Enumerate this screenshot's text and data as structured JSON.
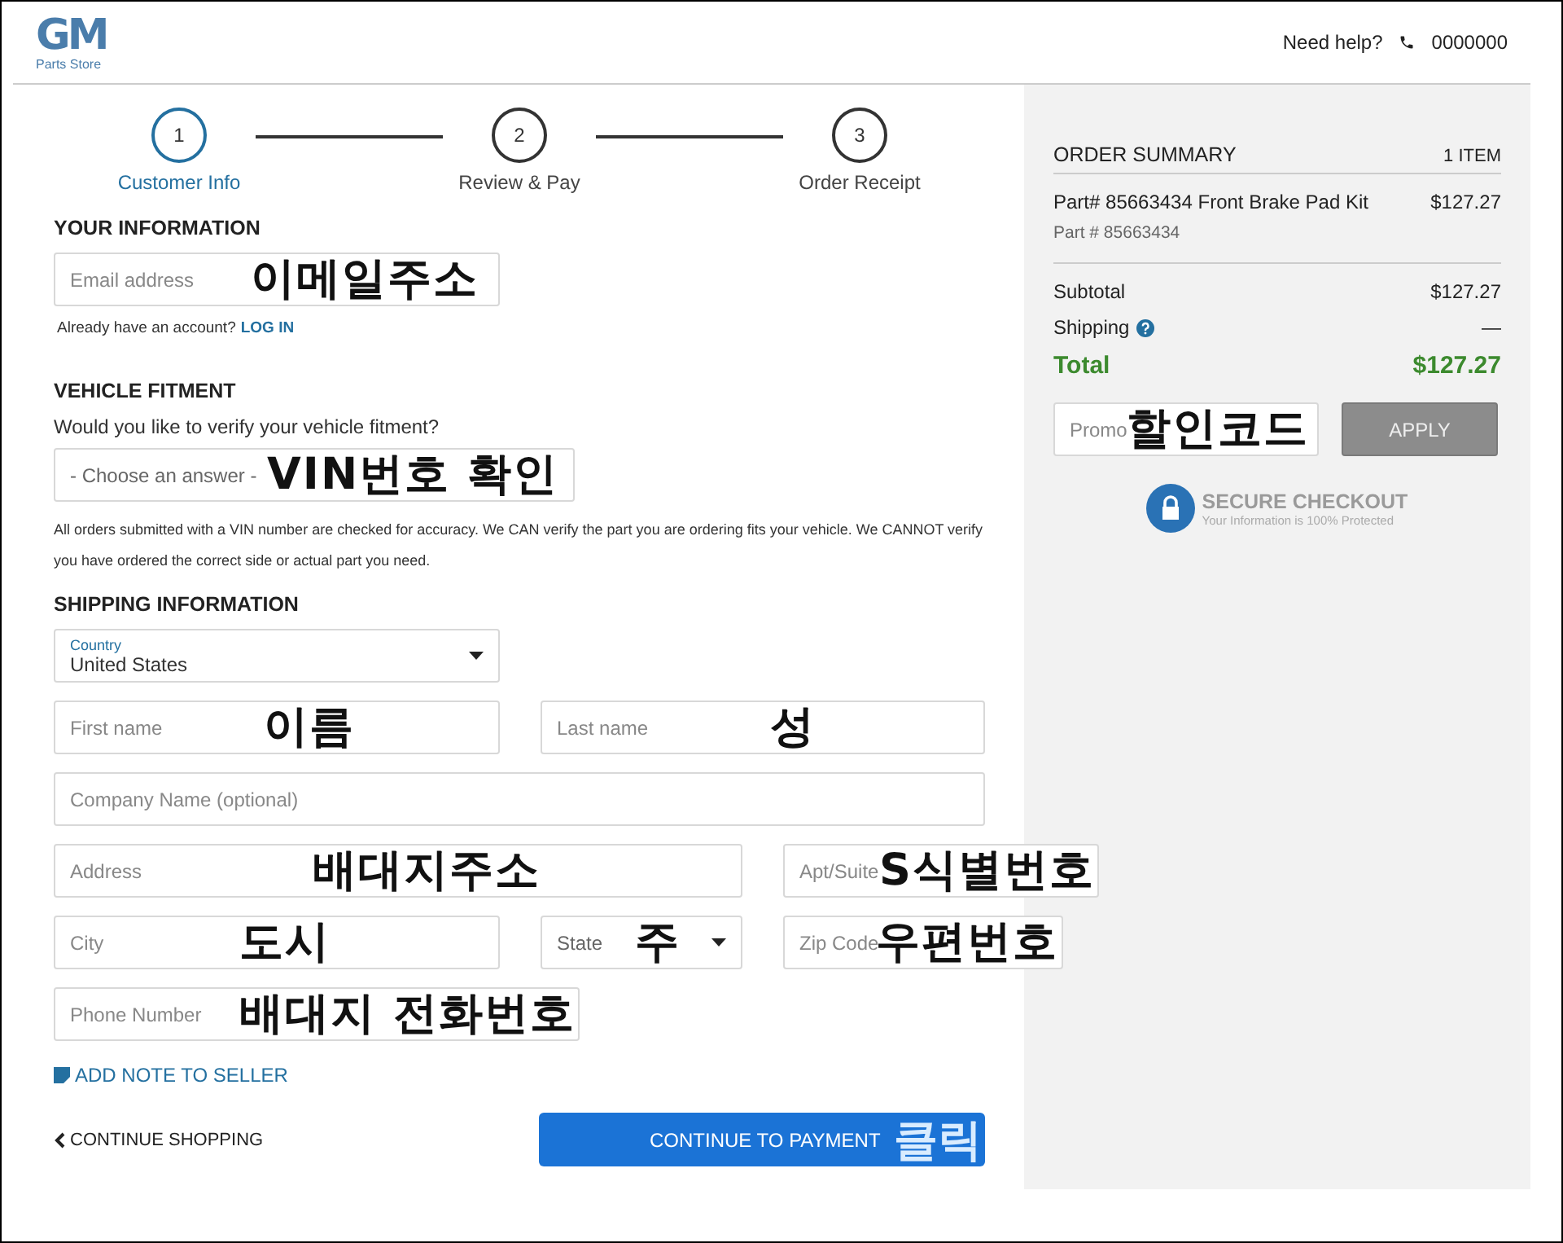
{
  "header": {
    "logo": {
      "mark": "GM",
      "name": "Parts Store"
    },
    "help": "Need help?",
    "phone": "0000000"
  },
  "steps": [
    {
      "number": "1",
      "label": "Customer Info",
      "selected": true
    },
    {
      "number": "2",
      "label": "Review & Pay",
      "selected": false
    },
    {
      "number": "3",
      "label": "Order Receipt",
      "selected": false
    }
  ],
  "your_information": {
    "title": "YOUR INFORMATION",
    "email": {
      "placeholder": "Email address",
      "annotation": "이메일주소"
    },
    "account_prompt": "Already have an account?",
    "login_link": "LOG IN"
  },
  "vehicle_fitment": {
    "title": "VEHICLE FITMENT",
    "question": "Would you like to verify your vehicle fitment?",
    "select": {
      "value": "- Choose an answer -",
      "annotation": "VIN번호 확인"
    },
    "note": "All orders submitted with a VIN number are checked for accuracy. We CAN verify the part you are ordering fits your vehicle. We CANNOT verify you have ordered the correct side or actual part you need."
  },
  "shipping": {
    "title": "SHIPPING INFORMATION",
    "fields": [
      {
        "kind": "select",
        "label": "Country",
        "value": "United States"
      },
      {
        "kind": "text",
        "placeholder": "First name",
        "annotation": "이름"
      },
      {
        "kind": "text",
        "placeholder": "Last name",
        "annotation": "성"
      },
      {
        "kind": "text",
        "placeholder": "Company Name (optional)"
      },
      {
        "kind": "text",
        "placeholder": "Address",
        "annotation": "배대지주소"
      },
      {
        "kind": "text",
        "placeholder": "Apt/Suite",
        "annotation": "S식별번호"
      },
      {
        "kind": "text",
        "placeholder": "City",
        "annotation": "도시"
      },
      {
        "kind": "select",
        "placeholder": "State",
        "annotation": "주"
      },
      {
        "kind": "text",
        "placeholder": "Zip Code",
        "annotation": "우편번호"
      },
      {
        "kind": "text",
        "placeholder": "Phone Number",
        "annotation": "배대지 전화번호"
      }
    ],
    "add_note": "ADD NOTE TO SELLER"
  },
  "actions": {
    "back": "CONTINUE SHOPPING",
    "next": "CONTINUE TO PAYMENT",
    "next_annotation": "클릭"
  },
  "summary": {
    "title": "ORDER SUMMARY",
    "count": "1 ITEM",
    "item": {
      "name": "Part# 85663434 Front Brake Pad Kit",
      "price": "$127.27",
      "part": "Part # 85663434"
    },
    "subtotal_label": "Subtotal",
    "subtotal": "$127.27",
    "shipping_label": "Shipping",
    "shipping": "—",
    "total_label": "Total",
    "total": "$127.27",
    "promo": {
      "placeholder": "Promo",
      "annotation": "할인코드"
    },
    "apply": "APPLY",
    "secure_title": "SECURE CHECKOUT",
    "secure_text": "Your Information is 100% Protected"
  }
}
